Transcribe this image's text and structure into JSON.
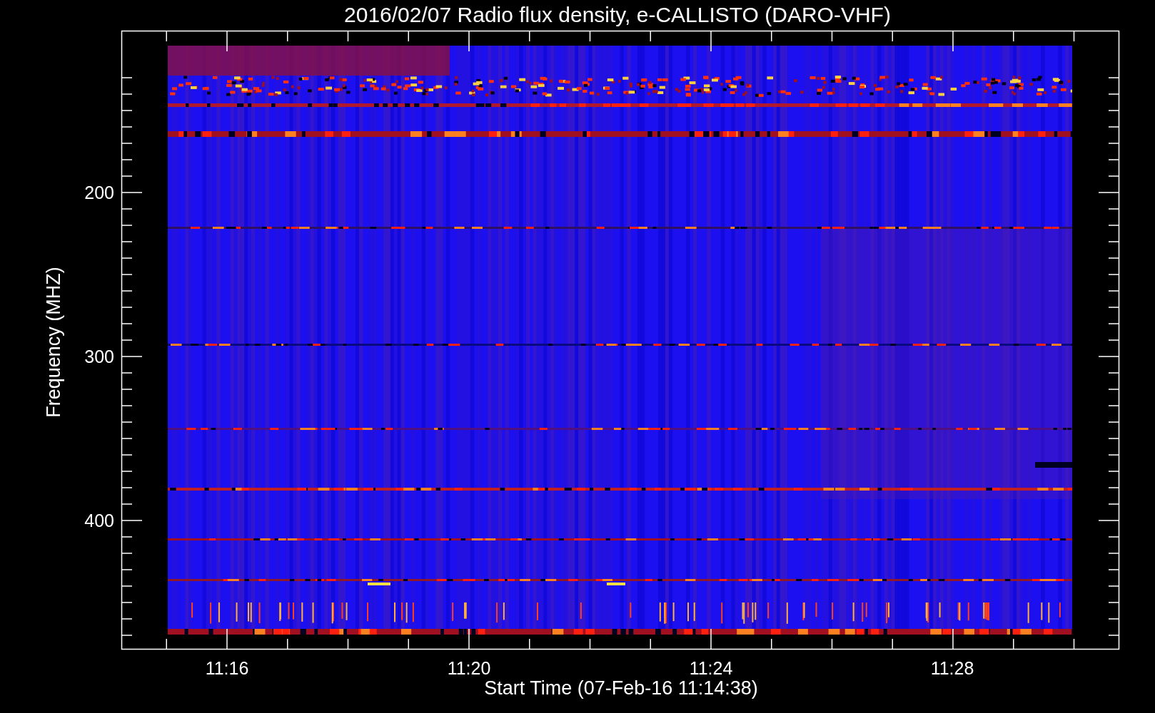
{
  "title": "2016/02/07  Radio flux density, e-CALLISTO (DARO-VHF)",
  "x_axis": {
    "label": "Start Time (07-Feb-16 11:14:38)",
    "ticks": [
      "11:16",
      "11:20",
      "11:24",
      "11:28"
    ]
  },
  "y_axis": {
    "label": "Frequency (MHZ)",
    "ticks": [
      "200",
      "300",
      "400"
    ]
  }
}
